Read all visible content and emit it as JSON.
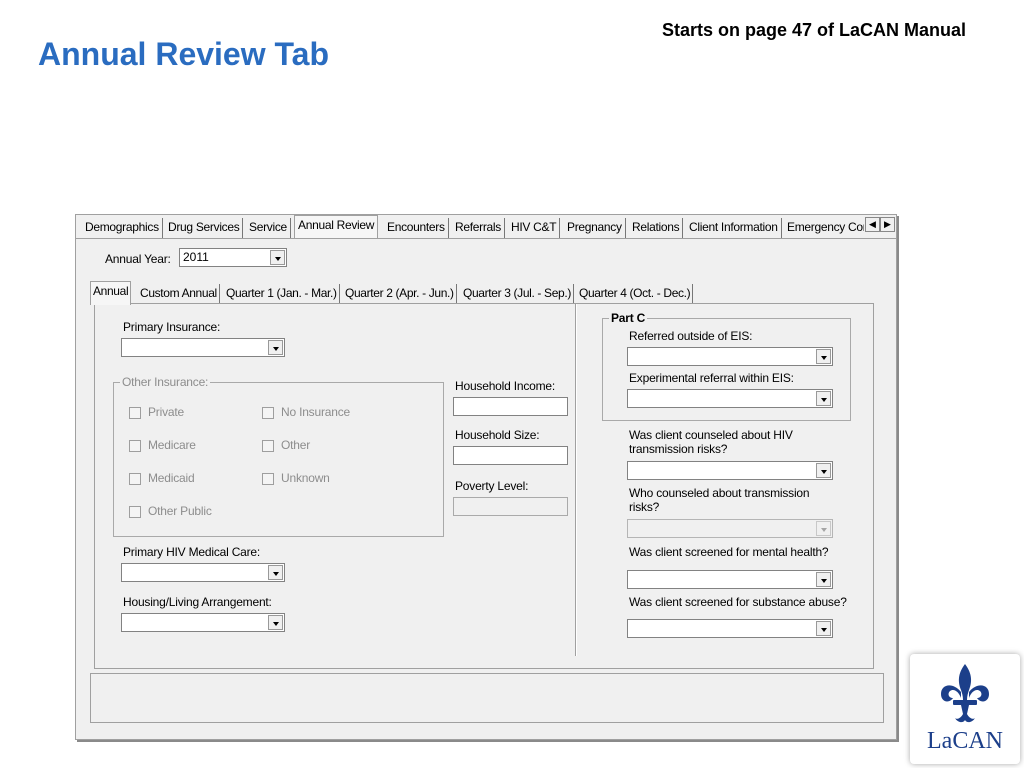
{
  "slide": {
    "title": "Annual Review Tab",
    "note": "Starts on page 47 of LaCAN Manual",
    "logo_text": "LaCAN",
    "accent_color": "#2a6cc0",
    "logo_color": "#1c3f8a"
  },
  "tabs": [
    {
      "label": "Demographics"
    },
    {
      "label": "Drug Services"
    },
    {
      "label": "Service"
    },
    {
      "label": "Annual Review",
      "active": true
    },
    {
      "label": "Encounters"
    },
    {
      "label": "Referrals"
    },
    {
      "label": "HIV C&T"
    },
    {
      "label": "Pregnancy"
    },
    {
      "label": "Relations"
    },
    {
      "label": "Client Information"
    },
    {
      "label": "Emergency Con"
    }
  ],
  "annual_year": {
    "label": "Annual Year:",
    "value": "2011"
  },
  "subtabs": [
    {
      "label": "Annual",
      "active": true
    },
    {
      "label": "Custom Annual"
    },
    {
      "label": "Quarter 1 (Jan. - Mar.)"
    },
    {
      "label": "Quarter 2 (Apr. - Jun.)"
    },
    {
      "label": "Quarter 3 (Jul. - Sep.)"
    },
    {
      "label": "Quarter 4 (Oct. - Dec.)"
    }
  ],
  "left": {
    "primary_insurance": "Primary Insurance:",
    "other_insurance": {
      "title": "Other Insurance:",
      "checkboxes": [
        "Private",
        "No Insurance",
        "Medicare",
        "Other",
        "Medicaid",
        "Unknown",
        "Other Public"
      ]
    },
    "primary_hiv_care": "Primary HIV Medical Care:",
    "housing": "Housing/Living Arrangement:"
  },
  "middle": {
    "household_income": "Household Income:",
    "household_size": "Household Size:",
    "poverty_level": "Poverty Level:"
  },
  "right": {
    "part_c": {
      "title": "Part C",
      "referred_outside": "Referred outside of EIS:",
      "experimental_referral": "Experimental referral within EIS:"
    },
    "counseled_hiv": "Was client counseled about HIV transmission risks?",
    "who_counseled": "Who counseled about transmission risks?",
    "screened_mental": "Was client screened for mental health?",
    "screened_substance": "Was client screened for substance abuse?"
  }
}
